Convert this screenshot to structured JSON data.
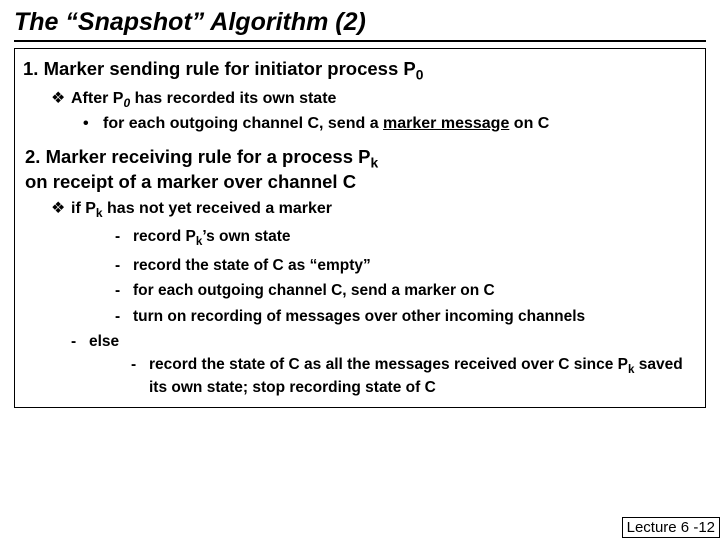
{
  "title": "The “Snapshot” Algorithm (2)",
  "rule1": {
    "heading_prefix": "1. Marker sending rule for initiator process P",
    "heading_sub": "0",
    "diamond_prefix": "After P",
    "diamond_sub": "0",
    "diamond_suffix": " has recorded its own state",
    "dot_prefix": " for each outgoing channel C, send a ",
    "dot_underline": "marker message",
    "dot_suffix": " on C"
  },
  "rule2": {
    "heading_line1_prefix": "2. Marker receiving rule for a process P",
    "heading_line1_sub": "k",
    "heading_line2": "  on receipt of a marker over channel C",
    "diamond_prefix": "if P",
    "diamond_sub": "k",
    "diamond_suffix": " has not yet received a marker",
    "dashes": {
      "d1_prefix": "record P",
      "d1_sub": "k",
      "d1_suffix": "’s own state",
      "d2": "record the state of C as “empty”",
      "d3": "for each outgoing channel C, send a marker on C",
      "d4": "turn on recording of messages over other incoming channels"
    },
    "else_label": "else",
    "else_line_prefix": "record the state of C as all the messages received over C since P",
    "else_line_sub": "k",
    "else_line_suffix": " saved its own state; stop recording state of C"
  },
  "footer": "Lecture 6 -12"
}
